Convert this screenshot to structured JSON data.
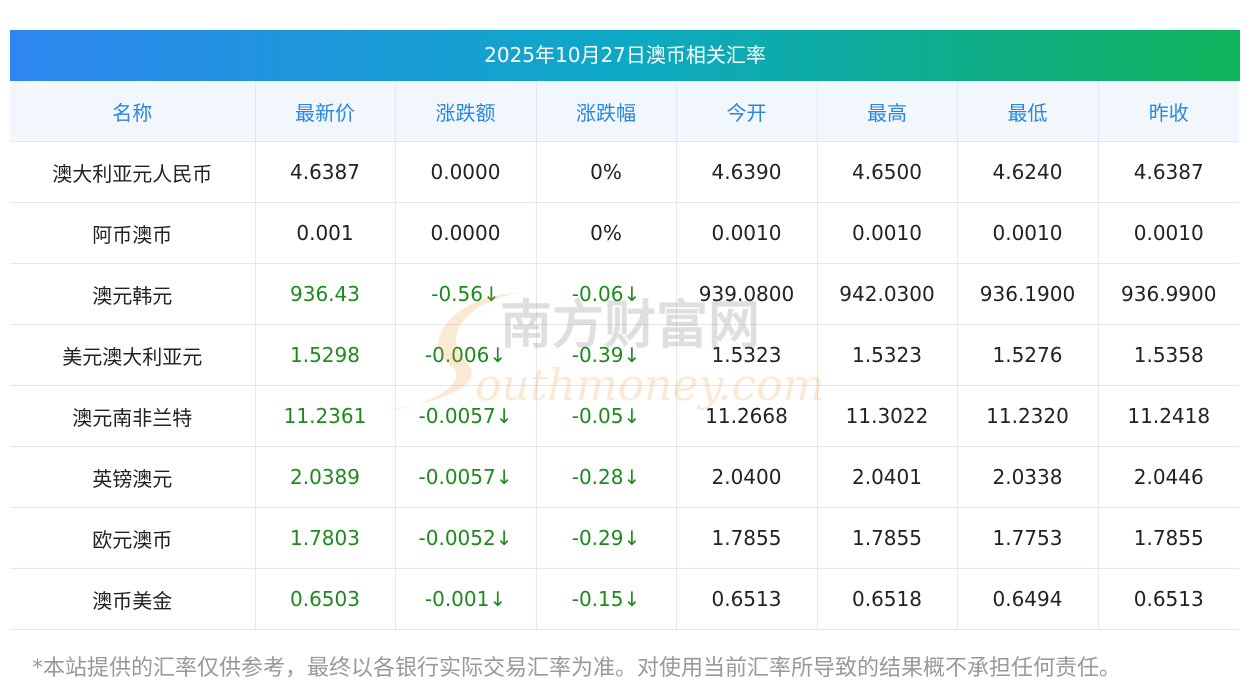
{
  "title": "2025年10月27日澳币相关汇率",
  "headers": [
    "名称",
    "最新价",
    "涨跌额",
    "涨跌幅",
    "今开",
    "最高",
    "最低",
    "昨收"
  ],
  "rows": [
    {
      "name": "澳大利亚元人民币",
      "latest": "4.6387",
      "change": "0.0000",
      "pct": "0%",
      "open": "4.6390",
      "high": "4.6500",
      "low": "4.6240",
      "prev": "4.6387",
      "down": false
    },
    {
      "name": "阿币澳币",
      "latest": "0.001",
      "change": "0.0000",
      "pct": "0%",
      "open": "0.0010",
      "high": "0.0010",
      "low": "0.0010",
      "prev": "0.0010",
      "down": false
    },
    {
      "name": "澳元韩元",
      "latest": "936.43",
      "change": "-0.56↓",
      "pct": "-0.06↓",
      "open": "939.0800",
      "high": "942.0300",
      "low": "936.1900",
      "prev": "936.9900",
      "down": true
    },
    {
      "name": "美元澳大利亚元",
      "latest": "1.5298",
      "change": "-0.006↓",
      "pct": "-0.39↓",
      "open": "1.5323",
      "high": "1.5323",
      "low": "1.5276",
      "prev": "1.5358",
      "down": true
    },
    {
      "name": "澳元南非兰特",
      "latest": "11.2361",
      "change": "-0.0057↓",
      "pct": "-0.05↓",
      "open": "11.2668",
      "high": "11.3022",
      "low": "11.2320",
      "prev": "11.2418",
      "down": true
    },
    {
      "name": "英镑澳元",
      "latest": "2.0389",
      "change": "-0.0057↓",
      "pct": "-0.28↓",
      "open": "2.0400",
      "high": "2.0401",
      "low": "2.0338",
      "prev": "2.0446",
      "down": true
    },
    {
      "name": "欧元澳币",
      "latest": "1.7803",
      "change": "-0.0052↓",
      "pct": "-0.29↓",
      "open": "1.7855",
      "high": "1.7855",
      "low": "1.7753",
      "prev": "1.7855",
      "down": true
    },
    {
      "name": "澳币美金",
      "latest": "0.6503",
      "change": "-0.001↓",
      "pct": "-0.15↓",
      "open": "0.6513",
      "high": "0.6518",
      "low": "0.6494",
      "prev": "0.6513",
      "down": true
    }
  ],
  "watermark": {
    "cn": "南方财富网",
    "en": "outhmoney.com",
    "icon": "s-swoosh-logo"
  },
  "footnote": "*本站提供的汇率仅供参考，最终以各银行实际交易汇率为准。对使用当前汇率所导致的结果概不承担任何责任。",
  "colors": {
    "header_text": "#2a86e0",
    "down": "#1e8a1e",
    "title_left": "#2f86f0",
    "title_right": "#10b25a"
  }
}
